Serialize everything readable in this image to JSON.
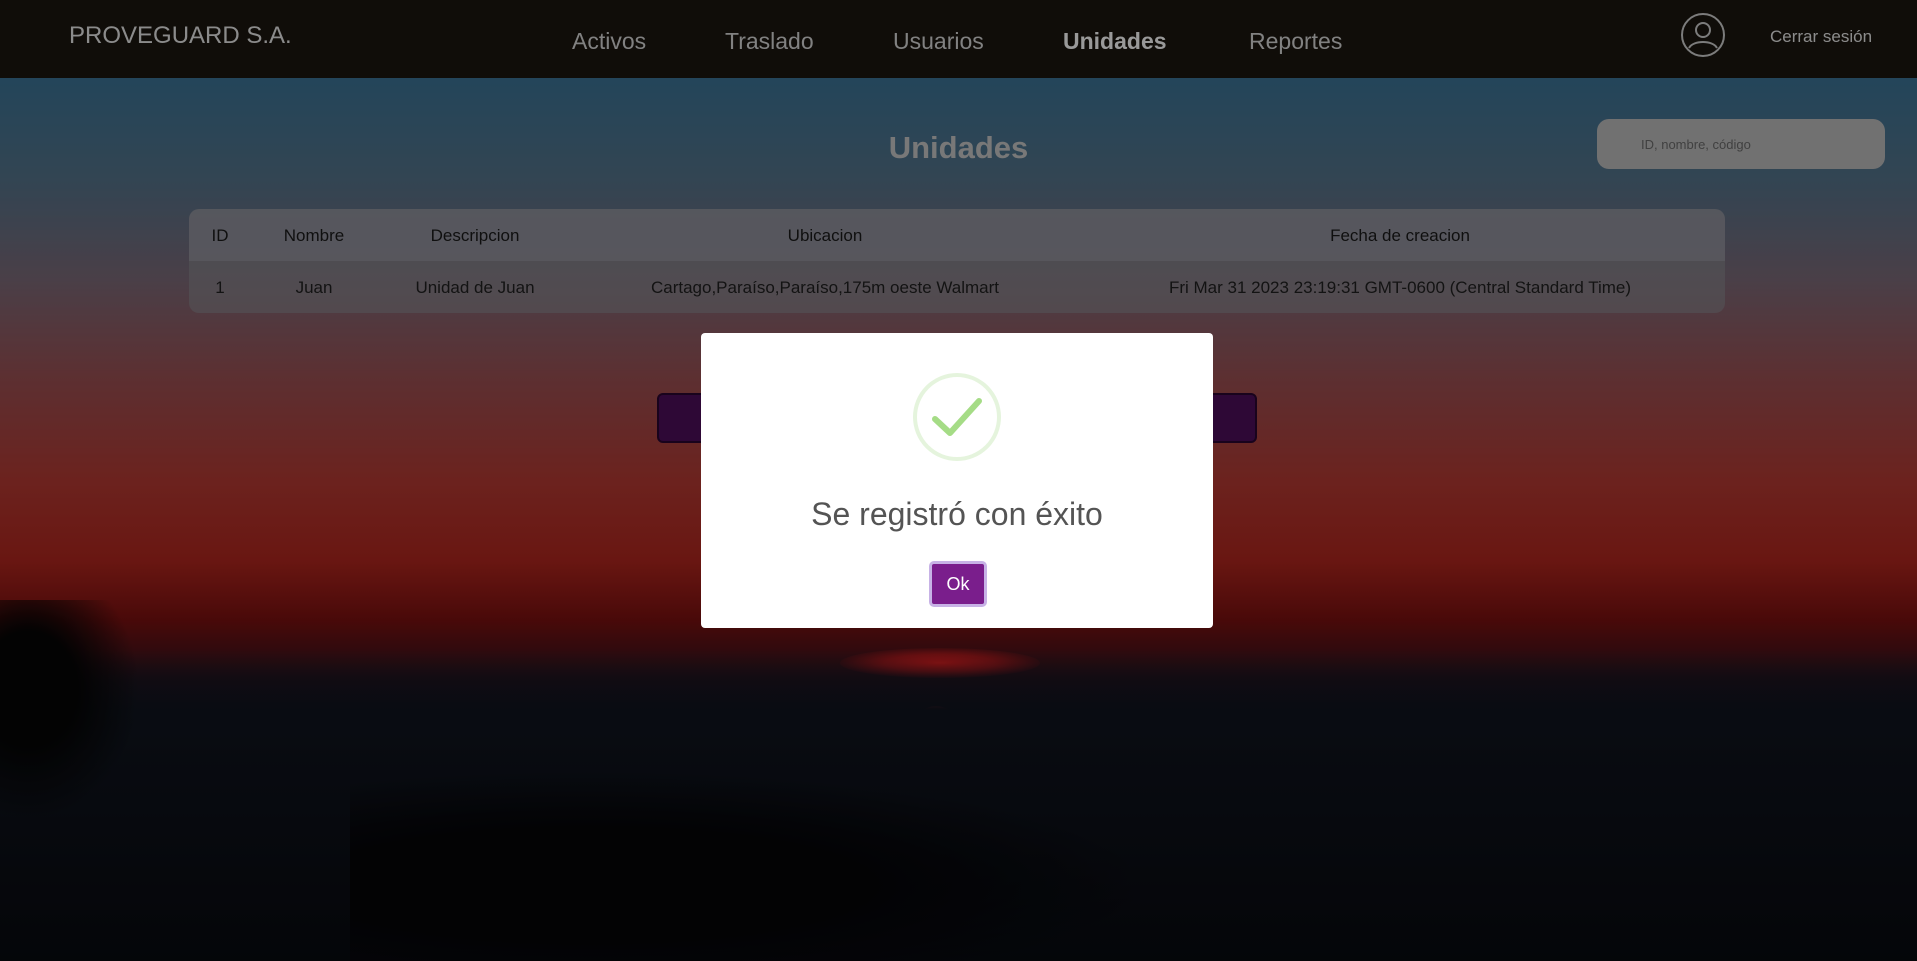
{
  "brand": "PROVEGUARD S.A.",
  "nav": {
    "items": [
      {
        "label": "Activos",
        "active": false
      },
      {
        "label": "Traslado",
        "active": false
      },
      {
        "label": "Usuarios",
        "active": false
      },
      {
        "label": "Unidades",
        "active": true
      },
      {
        "label": "Reportes",
        "active": false
      }
    ],
    "user_icon": "user-circle-icon",
    "logout_label": "Cerrar sesión"
  },
  "page": {
    "title": "Unidades",
    "search_placeholder": "ID, nombre, código"
  },
  "table": {
    "columns": [
      "ID",
      "Nombre",
      "Descripcion",
      "Ubicacion",
      "Fecha de creacion"
    ],
    "rows": [
      [
        "1",
        "Juan",
        "Unidad de Juan",
        "Cartago,Paraíso,Paraíso,175m oeste Walmart",
        "Fri Mar 31 2023 23:19:31 GMT-0600 (Central Standard Time)"
      ]
    ]
  },
  "modal": {
    "icon": "success-check-icon",
    "title": "Se registró con éxito",
    "ok_label": "Ok"
  },
  "colors": {
    "accent_purple": "#7a1e8c",
    "success_green": "#a5dc86",
    "navbar": "#1c160f"
  }
}
